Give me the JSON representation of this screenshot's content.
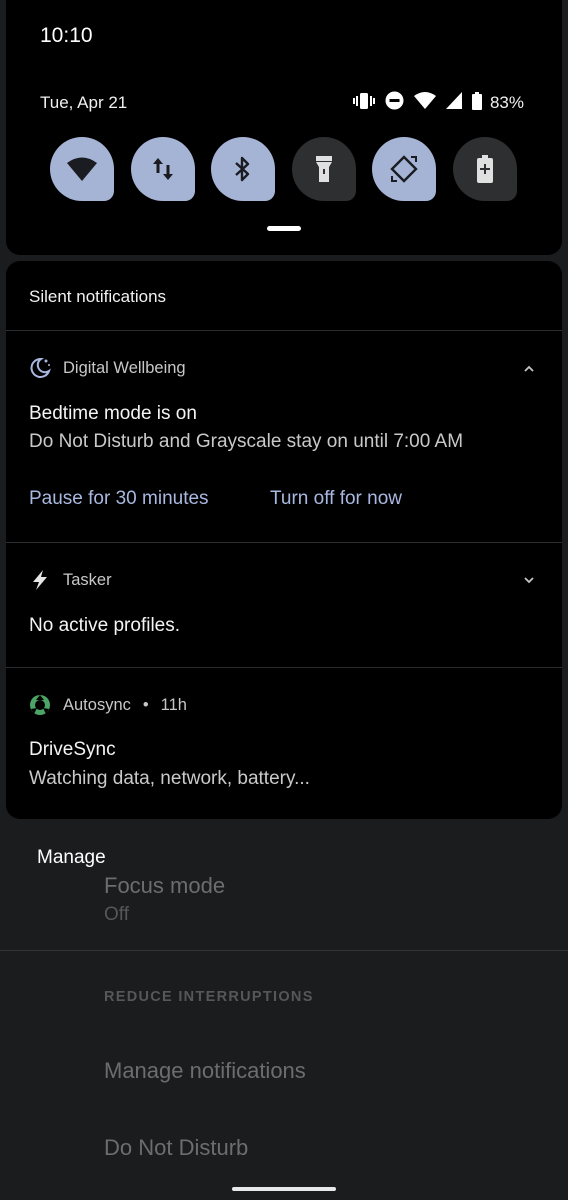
{
  "status_bar": {
    "time": "10:10",
    "date": "Tue, Apr 21",
    "battery_percent": "83%",
    "icons": [
      "vibrate-icon",
      "do-not-disturb-icon",
      "wifi-icon",
      "cell-signal-icon",
      "battery-icon"
    ]
  },
  "quick_settings": {
    "tiles": [
      {
        "name": "wifi-tile",
        "icon": "wifi-icon",
        "state": "on"
      },
      {
        "name": "mobile-data-tile",
        "icon": "data-arrows-icon",
        "state": "on"
      },
      {
        "name": "bluetooth-tile",
        "icon": "bluetooth-icon",
        "state": "on"
      },
      {
        "name": "flashlight-tile",
        "icon": "flashlight-icon",
        "state": "off"
      },
      {
        "name": "auto-rotate-tile",
        "icon": "rotate-icon",
        "state": "on"
      },
      {
        "name": "battery-saver-tile",
        "icon": "battery-saver-icon",
        "state": "off"
      }
    ],
    "accent_color": "#a5b4d4"
  },
  "notifications": {
    "section_title": "Silent notifications",
    "items": [
      {
        "app": "Digital Wellbeing",
        "icon": "moon-icon",
        "title": "Bedtime mode is on",
        "body": "Do Not Disturb and Grayscale stay on until 7:00 AM",
        "actions": [
          "Pause for 30 minutes",
          "Turn off for now"
        ],
        "expanded": true
      },
      {
        "app": "Tasker",
        "icon": "lightning-icon",
        "title": "No active profiles.",
        "expanded": false
      },
      {
        "app": "Autosync",
        "time": "11h",
        "icon": "autosync-icon",
        "title": "DriveSync",
        "body": "Watching data, network, battery..."
      }
    ],
    "manage_label": "Manage"
  },
  "background_settings": {
    "focus_mode_title": "Focus mode",
    "focus_mode_value": "Off",
    "section_header": "REDUCE INTERRUPTIONS",
    "manage_notifications": "Manage notifications",
    "do_not_disturb": "Do Not Disturb"
  },
  "autosync_meta_separator": "•"
}
